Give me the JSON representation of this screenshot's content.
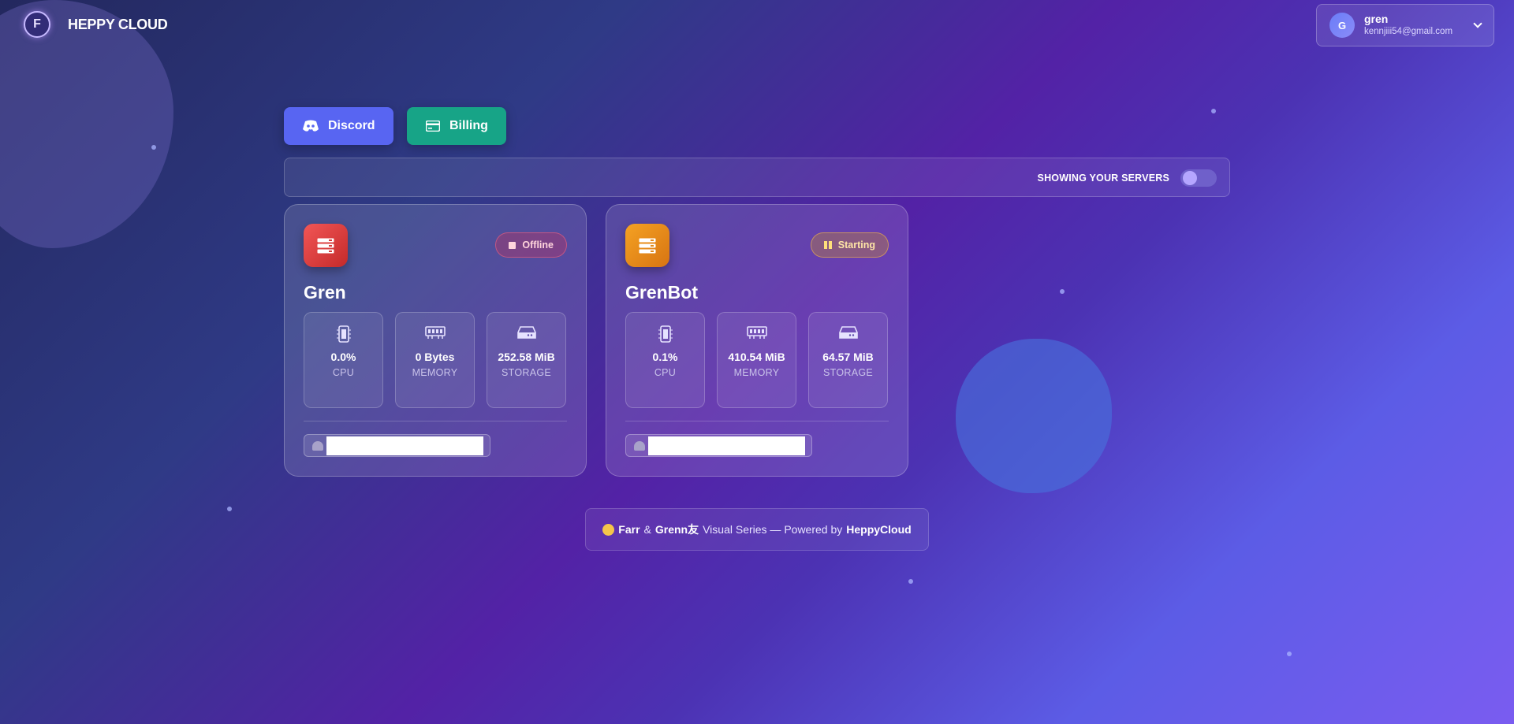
{
  "brand": {
    "name": "HEPPY CLOUD",
    "logo_letter": "F"
  },
  "user": {
    "initial": "G",
    "name": "gren",
    "email": "kennjiii54@gmail.com"
  },
  "actions": {
    "discord_label": "Discord",
    "billing_label": "Billing"
  },
  "filter": {
    "label": "SHOWING YOUR SERVERS",
    "toggle_on": false
  },
  "servers": [
    {
      "name": "Gren",
      "status": "Offline",
      "status_color": "#e0436c",
      "icon_color": "#e53e3e",
      "cpu": "0.0%",
      "cpu_label": "CPU",
      "memory": "0 Bytes",
      "memory_label": "MEMORY",
      "storage": "252.58 MiB",
      "storage_label": "STORAGE",
      "address": ""
    },
    {
      "name": "GrenBot",
      "status": "Starting",
      "status_color": "#f0a020",
      "icon_color": "#f08c1a",
      "cpu": "0.1%",
      "cpu_label": "CPU",
      "memory": "410.54 MiB",
      "memory_label": "MEMORY",
      "storage": "64.57 MiB",
      "storage_label": "STORAGE",
      "address": ""
    }
  ],
  "footer": {
    "part1": "Farr",
    "amp": "&",
    "part2": "Grenn友",
    "mid": "Visual Series — Powered by",
    "powered": "HeppyCloud"
  }
}
